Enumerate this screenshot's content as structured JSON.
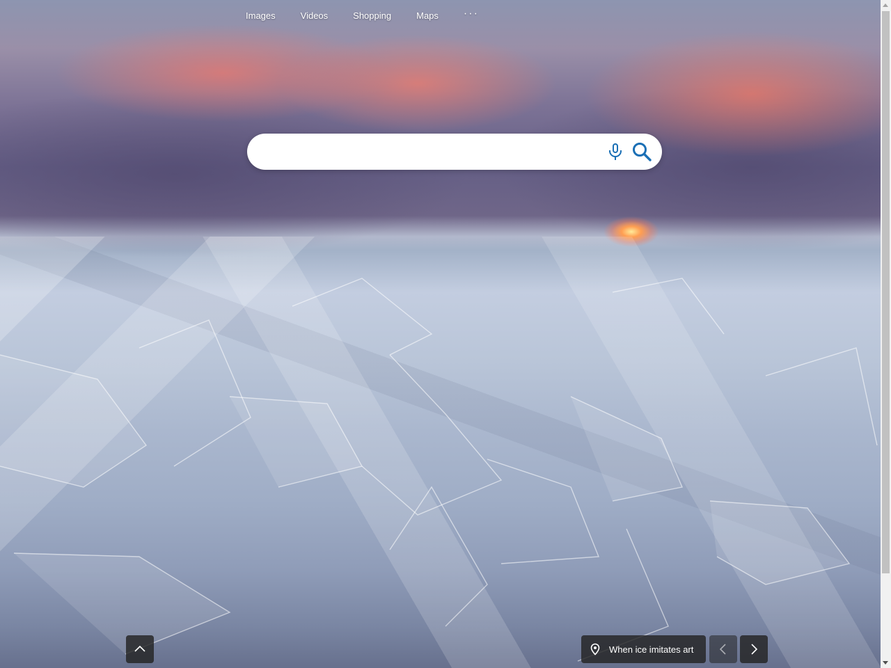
{
  "nav": {
    "items": [
      "Images",
      "Videos",
      "Shopping",
      "Maps"
    ],
    "more": "···"
  },
  "search": {
    "value": "",
    "placeholder": "",
    "mic_icon": "microphone-icon",
    "search_icon": "search-icon"
  },
  "background": {
    "caption": "When ice imitates art",
    "location_icon": "location-pin-icon",
    "prev_icon": "chevron-left-icon",
    "next_icon": "chevron-right-icon"
  },
  "scroll_up_icon": "chevron-up-icon",
  "colors": {
    "icon_blue": "#1a6fb5",
    "overlay": "#232323"
  }
}
